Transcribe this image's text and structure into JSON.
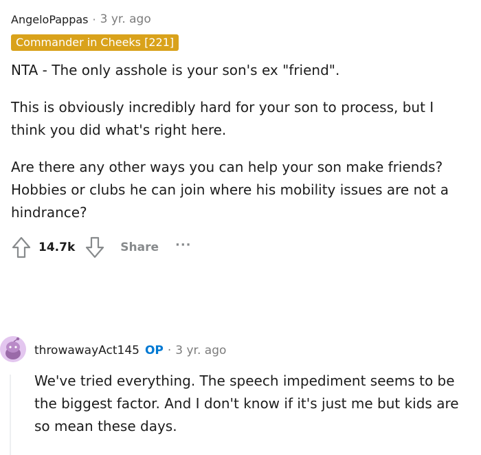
{
  "comment": {
    "author": "AngeloPappas",
    "separator": "·",
    "time": "3 yr. ago",
    "flair": "Commander in Cheeks [221]",
    "paragraphs": [
      "NTA - The only asshole is your son's ex \"friend\".",
      "This is obviously incredibly hard for your son to process, but I think you did what's right here.",
      "Are there any other ways you can help your son make friends? Hobbies or clubs he can join where his mobility issues are not a hindrance?"
    ],
    "score": "14.7k",
    "share_label": "Share",
    "more_label": "···"
  },
  "reply": {
    "author": "throwawayAct145",
    "op_badge": "OP",
    "separator": "·",
    "time": "3 yr. ago",
    "text": "We've tried everything. The speech impediment seems to be the biggest factor. And I don't know if it's just me but kids are so mean these days."
  },
  "colors": {
    "flair_bg": "#d9a21b",
    "op": "#0079d3",
    "muted": "#7c7c7c",
    "avatar": "#c18bd6"
  },
  "icons": {
    "upvote": "upvote-icon",
    "downvote": "downvote-icon",
    "more": "more-options-icon",
    "avatar": "snoo-avatar-icon"
  }
}
